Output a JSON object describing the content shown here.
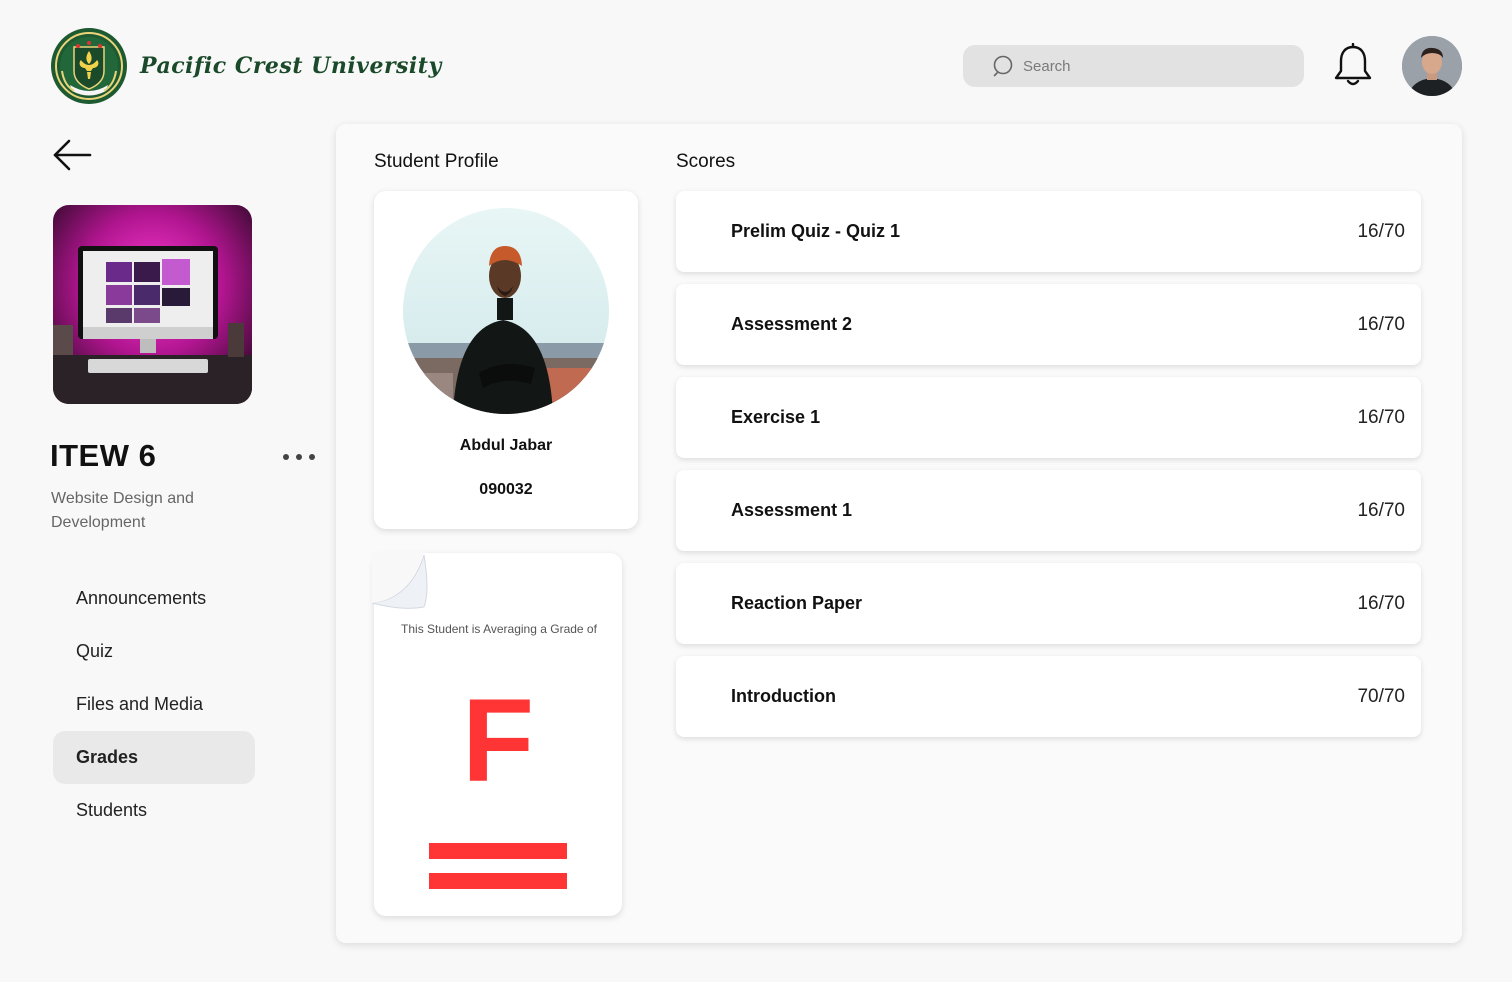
{
  "header": {
    "logo_text": "Pacific Crest University",
    "search_placeholder": "Search"
  },
  "course": {
    "code": "ITEW 6",
    "name": "Website Design and Development"
  },
  "sidebar": {
    "items": [
      {
        "label": "Announcements",
        "active": false
      },
      {
        "label": "Quiz",
        "active": false
      },
      {
        "label": "Files and Media",
        "active": false
      },
      {
        "label": "Grades",
        "active": true
      },
      {
        "label": "Students",
        "active": false
      }
    ]
  },
  "profile": {
    "section_title": "Student Profile",
    "name": "Abdul Jabar",
    "student_id": "090032"
  },
  "grade": {
    "caption": "This Student is Averaging a Grade of",
    "letter": "F",
    "color": "#ff3535"
  },
  "scores": {
    "section_title": "Scores",
    "items": [
      {
        "title": "Prelim Quiz - Quiz 1",
        "score": "16/70"
      },
      {
        "title": "Assessment 2",
        "score": "16/70"
      },
      {
        "title": "Exercise 1",
        "score": "16/70"
      },
      {
        "title": "Assessment 1",
        "score": "16/70"
      },
      {
        "title": "Reaction Paper",
        "score": "16/70"
      },
      {
        "title": "Introduction",
        "score": "70/70"
      }
    ]
  },
  "colors": {
    "brand_green": "#1a4a2a",
    "accent_red": "#ff3535",
    "active_nav": "#e9e9e9"
  },
  "icons": [
    "university-seal-icon",
    "search-icon",
    "bell-icon",
    "back-arrow-icon",
    "more-dots-icon"
  ]
}
